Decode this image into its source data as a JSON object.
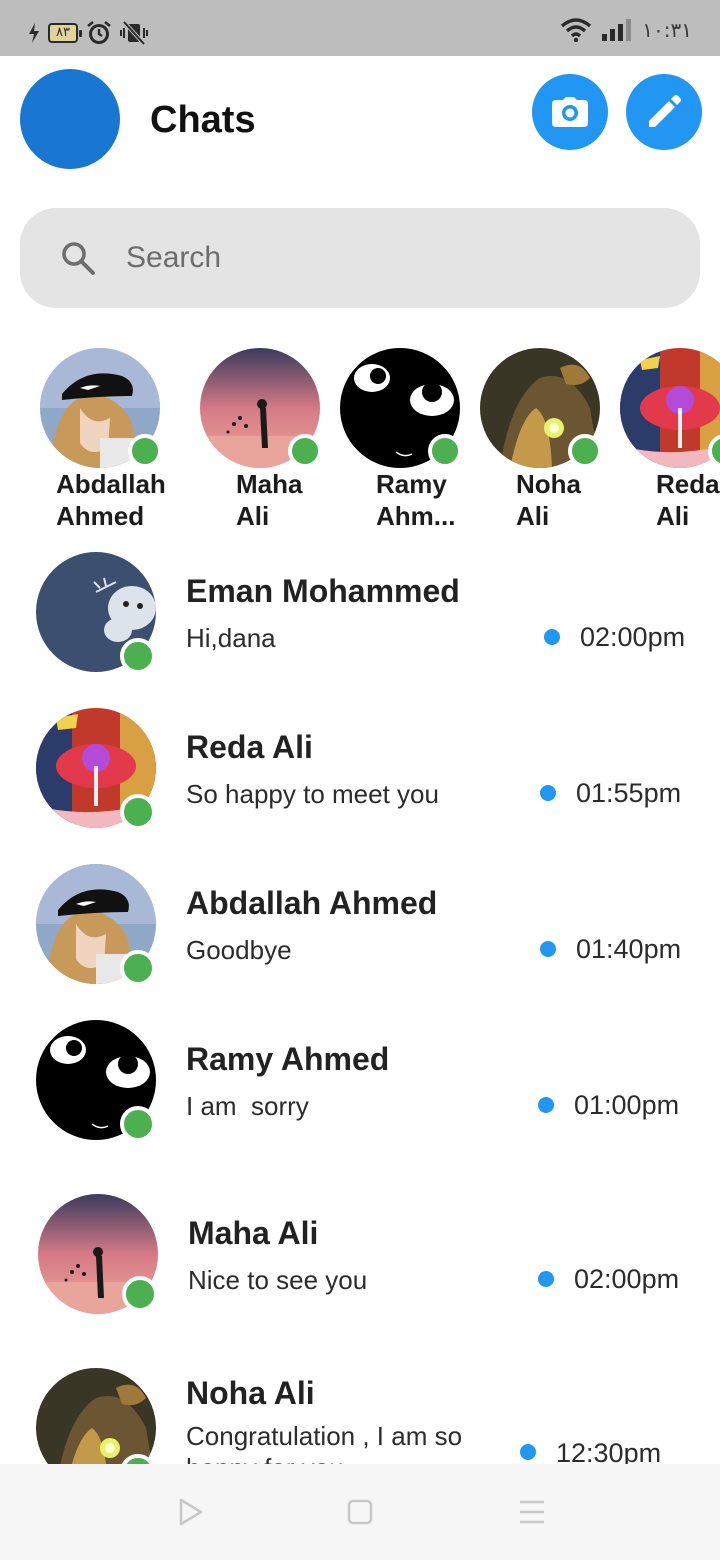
{
  "status_bar": {
    "battery_level": "٨٣",
    "time": "١٠:٣١",
    "icons": [
      "charging-icon",
      "alarm-icon",
      "vibrate-off-icon",
      "wifi-icon",
      "signal-icon"
    ]
  },
  "header": {
    "title": "Chats",
    "camera_icon": "camera-icon",
    "compose_icon": "pencil-icon",
    "accent_color": "#2196f3",
    "profile_color": "#1976d2"
  },
  "search": {
    "placeholder": "Search"
  },
  "stories": [
    {
      "first": "Abdallah",
      "second": "Ahmed",
      "online": true
    },
    {
      "first": "Maha",
      "second": "Ali",
      "online": true
    },
    {
      "first": "Ramy",
      "second": "Ahm...",
      "online": true
    },
    {
      "first": "Noha",
      "second": "Ali",
      "online": true
    },
    {
      "first": "Reda",
      "second": "Ali",
      "online": true
    }
  ],
  "chats": [
    {
      "name": "Eman Mohammed",
      "message": "Hi,dana",
      "time": "02:00pm",
      "unread": true,
      "online": true
    },
    {
      "name": "Reda Ali",
      "message": "So happy to meet you",
      "time": "01:55pm",
      "unread": true,
      "online": true
    },
    {
      "name": "Abdallah Ahmed",
      "message": "Goodbye",
      "time": "01:40pm",
      "unread": true,
      "online": true
    },
    {
      "name": "Ramy Ahmed",
      "message": "I am  sorry",
      "time": "01:00pm",
      "unread": true,
      "online": true
    },
    {
      "name": "Maha Ali",
      "message": "Nice to see you",
      "time": "02:00pm",
      "unread": true,
      "online": true
    },
    {
      "name": "Noha Ali",
      "message": "Congratulation , I am so happy for you",
      "time": "12:30pm",
      "unread": true,
      "online": true
    }
  ],
  "colors": {
    "online": "#4caf50",
    "unread": "#2196f3"
  }
}
